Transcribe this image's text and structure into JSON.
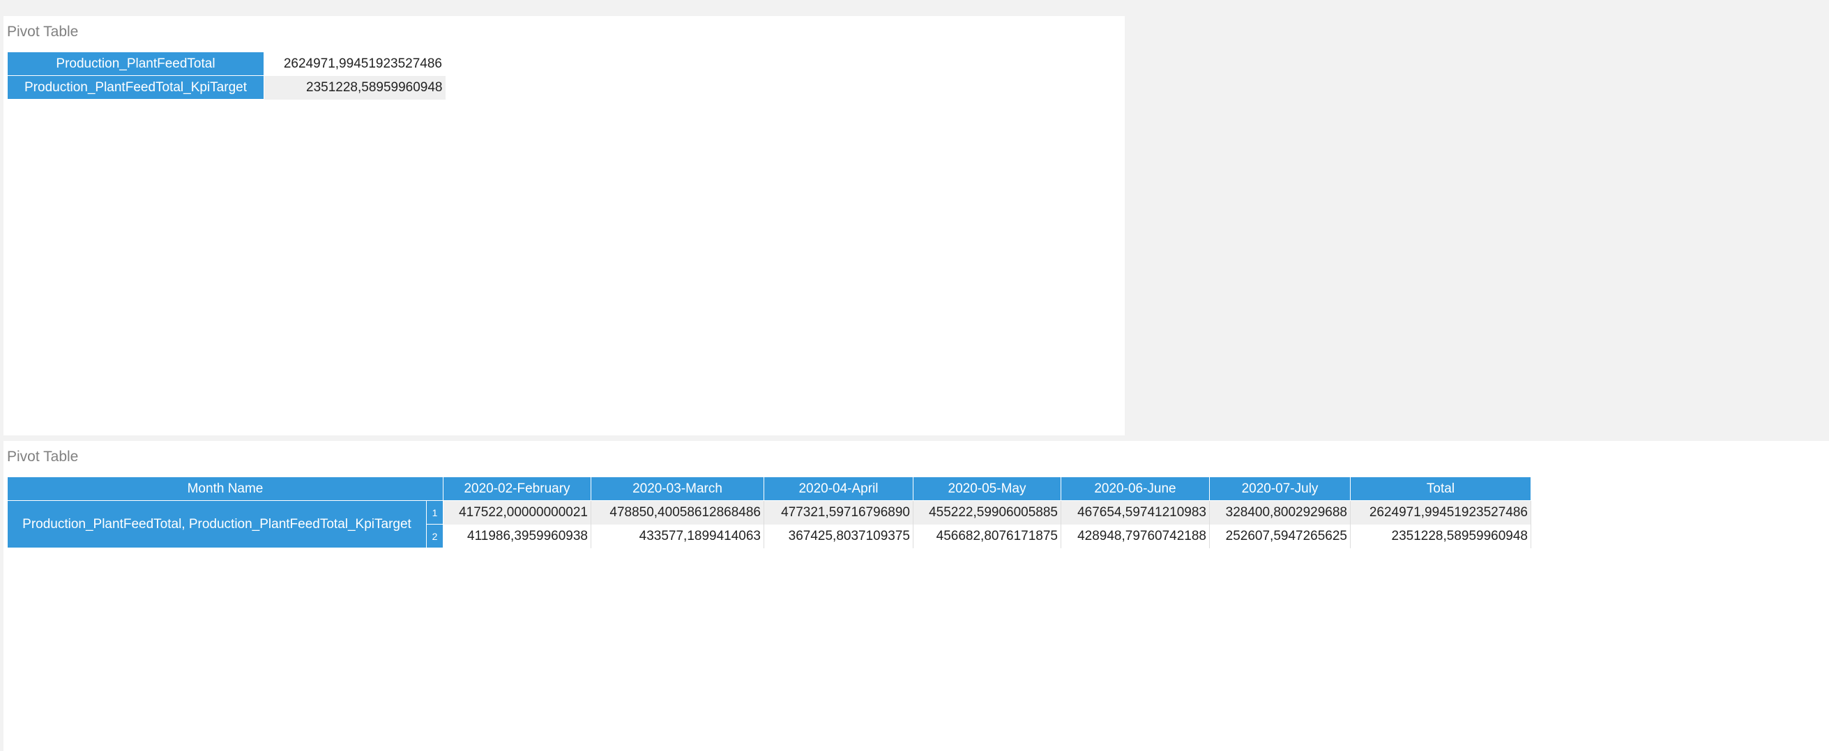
{
  "panels": [
    {
      "title": "Pivot Table",
      "kpi_rows": [
        {
          "label": "Production_PlantFeedTotal",
          "value": "2624971,99451923527486"
        },
        {
          "label": "Production_PlantFeedTotal_KpiTarget",
          "value": "2351228,58959960948"
        }
      ]
    },
    {
      "title": "Pivot Table",
      "corner_header": "Month Name",
      "row_header": "Production_PlantFeedTotal, Production_PlantFeedTotal_KpiTarget",
      "columns": [
        "2020-02-February",
        "2020-03-March",
        "2020-04-April",
        "2020-05-May",
        "2020-06-June",
        "2020-07-July",
        "Total"
      ],
      "rows": [
        {
          "index": "1",
          "values": [
            "417522,00000000021",
            "478850,40058612868486",
            "477321,59716796890",
            "455222,59906005885",
            "467654,59741210983",
            "328400,8002929688",
            "2624971,99451923527486"
          ]
        },
        {
          "index": "2",
          "values": [
            "411986,3959960938",
            "433577,1899414063",
            "367425,8037109375",
            "456682,8076171875",
            "428948,79760742188",
            "252607,5947265625",
            "2351228,58959960948"
          ]
        }
      ]
    }
  ],
  "colors": {
    "header_bg": "#3498db",
    "header_text": "#ffffff",
    "page_bg": "#f2f2f2",
    "alt_row_bg": "#efefef"
  }
}
